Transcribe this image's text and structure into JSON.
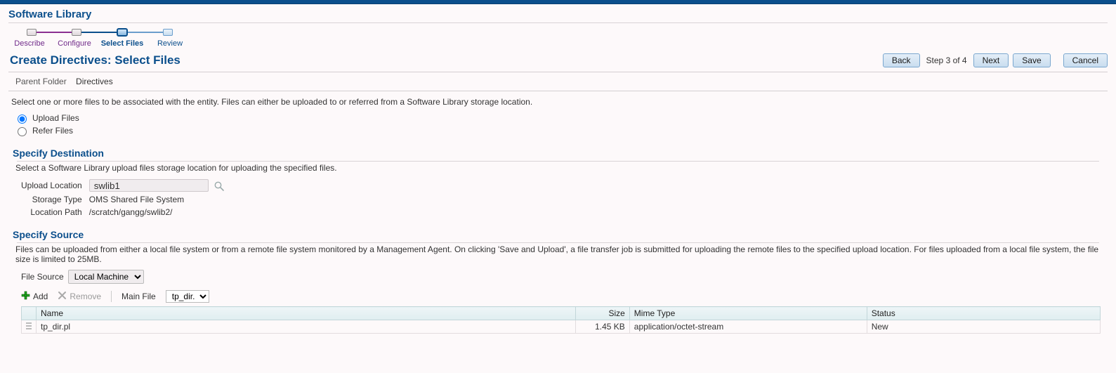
{
  "app_title": "Software Library",
  "train": {
    "steps": [
      {
        "label": "Describe",
        "state": "visited"
      },
      {
        "label": "Configure",
        "state": "visited"
      },
      {
        "label": "Select Files",
        "state": "current"
      },
      {
        "label": "Review",
        "state": "future"
      }
    ]
  },
  "page_heading": "Create Directives: Select Files",
  "buttons": {
    "back": "Back",
    "step_text": "Step 3 of 4",
    "next": "Next",
    "save": "Save",
    "cancel": "Cancel"
  },
  "parent_folder": {
    "label": "Parent Folder",
    "value": "Directives"
  },
  "instruction": "Select one or more files to be associated with the entity. Files can either be uploaded to or referred from a Software Library storage location.",
  "radios": {
    "upload": "Upload Files",
    "refer": "Refer Files",
    "selected": "upload"
  },
  "destination": {
    "title": "Specify Destination",
    "instruction": "Select a Software Library upload files storage location for uploading the specified files.",
    "fields": {
      "upload_location": {
        "label": "Upload Location",
        "value": "swlib1"
      },
      "storage_type": {
        "label": "Storage Type",
        "value": "OMS Shared File System"
      },
      "location_path": {
        "label": "Location Path",
        "value": "/scratch/gangg/swlib2/"
      }
    }
  },
  "source": {
    "title": "Specify Source",
    "instruction": "Files can be uploaded from either a local file system or from a remote file system monitored by a Management Agent. On clicking 'Save and Upload', a file transfer job is submitted for uploading the remote files to the specified upload location. For files uploaded from a local file system, the file size is limited to 25MB.",
    "file_source": {
      "label": "File Source",
      "value": "Local Machine"
    },
    "toolbar": {
      "add": "Add",
      "remove": "Remove",
      "main_file_label": "Main File",
      "main_file_value": "tp_dir.pl"
    },
    "columns": {
      "name": "Name",
      "size": "Size",
      "mime": "Mime Type",
      "status": "Status"
    },
    "rows": [
      {
        "name": "tp_dir.pl",
        "size": "1.45 KB",
        "mime": "application/octet-stream",
        "status": "New"
      }
    ]
  }
}
